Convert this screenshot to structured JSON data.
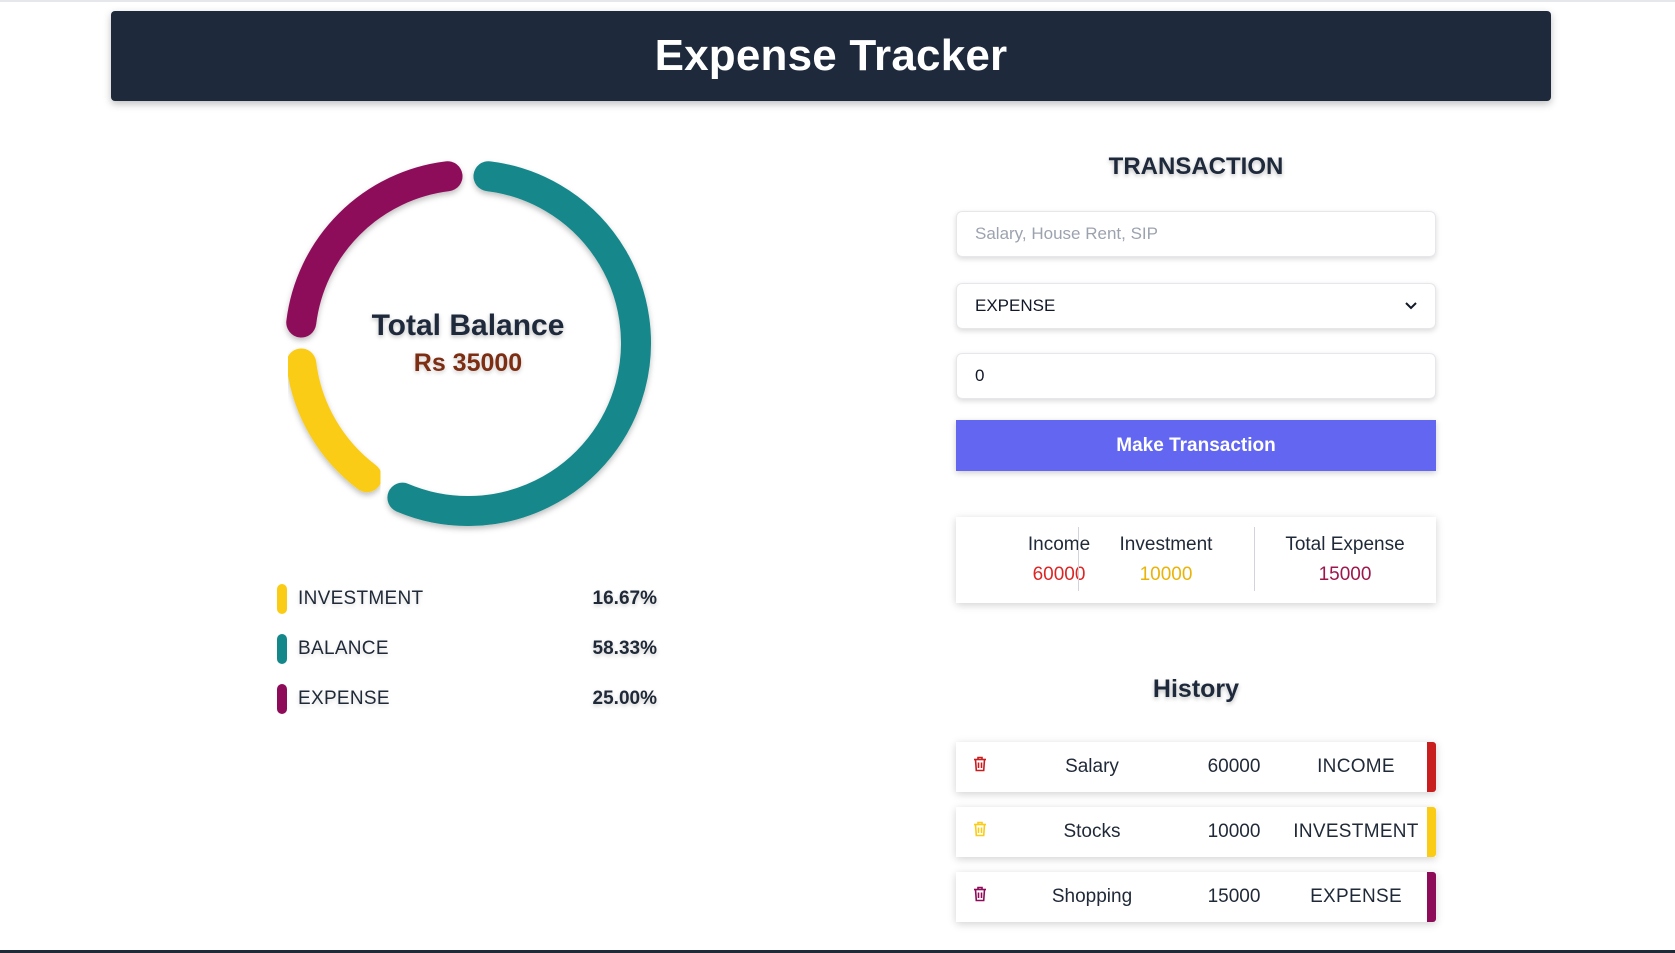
{
  "header": {
    "title": "Expense Tracker"
  },
  "chart_data": {
    "type": "pie",
    "center_title": "Total Balance",
    "center_value": "Rs 35000",
    "series": [
      {
        "name": "INVESTMENT",
        "value": 16.67,
        "label": "16.67%",
        "color": "#facc15"
      },
      {
        "name": "BALANCE",
        "value": 58.33,
        "label": "58.33%",
        "color": "#13878a"
      },
      {
        "name": "EXPENSE",
        "value": 25.0,
        "label": "25.00%",
        "color": "#8e0b5a"
      }
    ]
  },
  "transaction": {
    "title": "TRANSACTION",
    "description_placeholder": "Salary, House Rent, SIP",
    "type_selected": "EXPENSE",
    "amount_value": "0",
    "submit_label": "Make Transaction"
  },
  "summary": {
    "income": {
      "label": "Income",
      "value": "60000",
      "color": "#dc2626"
    },
    "investment": {
      "label": "Investment",
      "value": "10000",
      "color": "#eab308"
    },
    "expense": {
      "label": "Total Expense",
      "value": "15000",
      "color": "#9d174d"
    }
  },
  "history": {
    "title": "History",
    "items": [
      {
        "name": "Salary",
        "amount": "60000",
        "type": "INCOME",
        "color": "#c81e1e",
        "icon": "trash-icon"
      },
      {
        "name": "Stocks",
        "amount": "10000",
        "type": "INVESTMENT",
        "color": "#facc15",
        "icon": "trash-icon"
      },
      {
        "name": "Shopping",
        "amount": "15000",
        "type": "EXPENSE",
        "color": "#8e0b5a",
        "icon": "trash-icon"
      }
    ]
  }
}
